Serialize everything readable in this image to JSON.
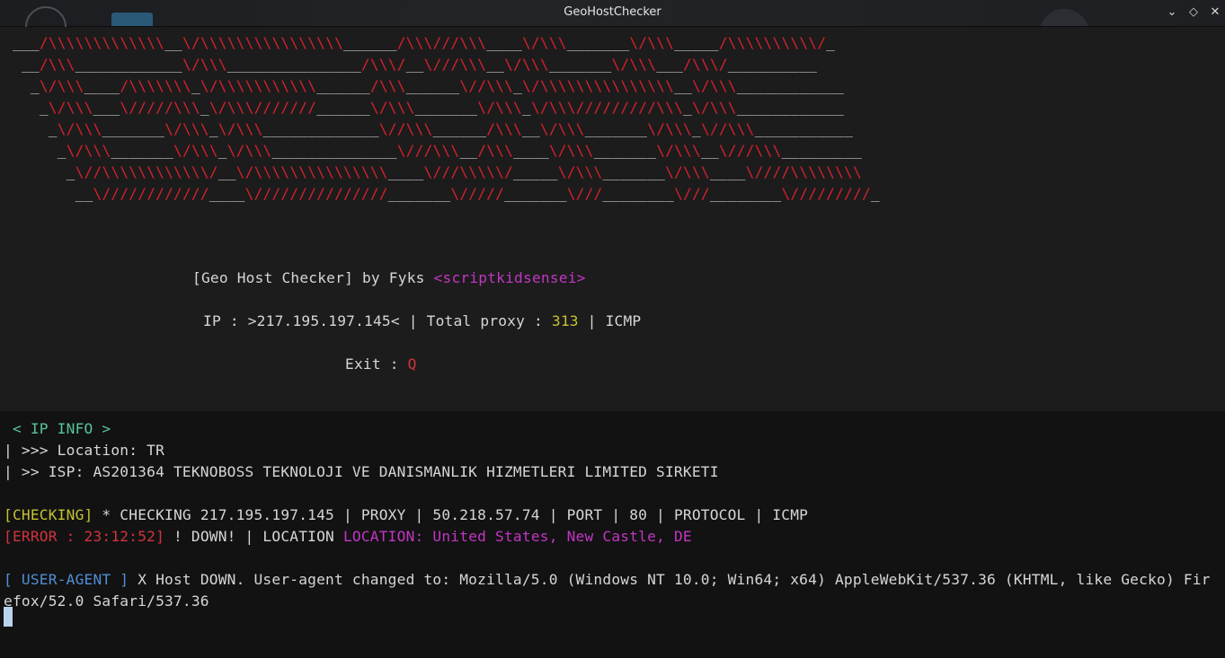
{
  "window": {
    "title": "GeoHostChecker",
    "buttons": {
      "minimize": "⌄",
      "maximize": "◇",
      "close": "✕"
    }
  },
  "banner": {
    "lines": [
      "___/\\\\\\\\\\\\\\\\\\\\\\\\\\__\\/\\\\\\\\\\\\\\\\\\\\\\\\\\\\\\\\______/\\\\\\///\\\\\\____\\/\\\\\\_______\\/\\\\\\_____/\\\\\\\\\\\\\\\\\\\\/_",
      " __/\\\\\\____________\\/\\\\\\_______________/\\\\\\/__\\///\\\\\\__\\/\\\\\\_______\\/\\\\\\___/\\\\\\/__________",
      "  _\\/\\\\\\____/\\\\\\\\\\\\\\_\\/\\\\\\\\\\\\\\\\\\\\\\______/\\\\\\______\\//\\\\\\_\\/\\\\\\\\\\\\\\\\\\\\\\\\\\\\\\__\\/\\\\\\____________",
      "   _\\/\\\\\\___\\/////\\\\\\_\\/\\\\\\///////______\\/\\\\\\_______\\/\\\\\\_\\/\\\\\\/////////\\\\\\_\\/\\\\\\____________",
      "    _\\/\\\\\\_______\\/\\\\\\_\\/\\\\\\_____________\\//\\\\\\______/\\\\\\__\\/\\\\\\_______\\/\\\\\\_\\//\\\\\\___________",
      "     _\\/\\\\\\_______\\/\\\\\\_\\/\\\\\\______________\\///\\\\\\__/\\\\\\____\\/\\\\\\_______\\/\\\\\\__\\///\\\\\\_________",
      "      _\\//\\\\\\\\\\\\\\\\\\\\\\\\/__\\/\\\\\\\\\\\\\\\\\\\\\\\\\\\\\\____\\///\\\\\\\\\\/_____\\/\\\\\\_______\\/\\\\\\____\\////\\\\\\\\\\\\\\\\",
      "       __\\////////////____\\///////////////_______\\/////_______\\///________\\///________\\/////////_"
    ]
  },
  "header": {
    "prefix": "[Geo Host Checker] by Fyks ",
    "author": "<scriptkidsensei>",
    "ip_label": "IP : ",
    "ip_value": ">217.195.197.145<",
    "total_label": " | Total proxy : ",
    "total_value": "313",
    "mode_label": " | ICMP",
    "exit_label": "Exit : ",
    "exit_key": "Q"
  },
  "ip_info": {
    "heading": " < IP INFO >",
    "location_line": "| >>> Location: TR",
    "isp_line": "| >> ISP: AS201364 TEKNOBOSS TEKNOLOJI VE DANISMANLIK HIZMETLERI LIMITED SIRKETI"
  },
  "log": {
    "checking_tag": "[CHECKING]",
    "checking_text": " * CHECKING 217.195.197.145 | PROXY | 50.218.57.74 | PORT | 80 | PROTOCOL | ICMP",
    "error_tag": "[ERROR : 23:12:52]",
    "error_text": " ! DOWN! | LOCATION ",
    "error_location": "LOCATION: United States, New Castle, DE",
    "ua_tag": "[ USER-AGENT ]",
    "ua_text_1": " X Host DOWN. User-agent changed to: Mozilla/5.0 (Windows NT 10.0; Win64; x64) AppleWebKit/537.36 (KHTML, like Gecko) Fir",
    "ua_text_2": "efox/52.0 Safari/537.36"
  },
  "colors": {
    "banner_red": "#d4212d",
    "author_magenta": "#c236c4",
    "count_yellow": "#c5c132",
    "error_red": "#d2333d",
    "info_teal": "#57c59a",
    "useragent_blue": "#4f8fd6"
  }
}
